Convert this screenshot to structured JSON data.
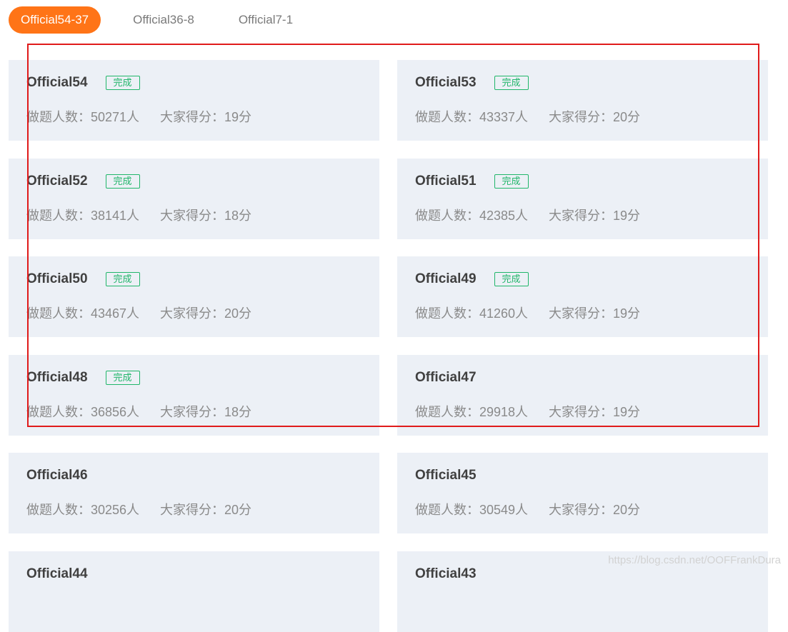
{
  "tabs": [
    {
      "label": "Official54-37",
      "active": true
    },
    {
      "label": "Official36-8",
      "active": false
    },
    {
      "label": "Official7-1",
      "active": false
    }
  ],
  "cards": [
    {
      "title": "Official54",
      "badge": "完成",
      "people": "做题人数：50271人",
      "score": "大家得分：19分"
    },
    {
      "title": "Official53",
      "badge": "完成",
      "people": "做题人数：43337人",
      "score": "大家得分：20分"
    },
    {
      "title": "Official52",
      "badge": "完成",
      "people": "做题人数：38141人",
      "score": "大家得分：18分"
    },
    {
      "title": "Official51",
      "badge": "完成",
      "people": "做题人数：42385人",
      "score": "大家得分：19分"
    },
    {
      "title": "Official50",
      "badge": "完成",
      "people": "做题人数：43467人",
      "score": "大家得分：20分"
    },
    {
      "title": "Official49",
      "badge": "完成",
      "people": "做题人数：41260人",
      "score": "大家得分：19分"
    },
    {
      "title": "Official48",
      "badge": "完成",
      "people": "做题人数：36856人",
      "score": "大家得分：18分"
    },
    {
      "title": "Official47",
      "badge": "",
      "people": "做题人数：29918人",
      "score": "大家得分：19分"
    },
    {
      "title": "Official46",
      "badge": "",
      "people": "做题人数：30256人",
      "score": "大家得分：20分"
    },
    {
      "title": "Official45",
      "badge": "",
      "people": "做题人数：30549人",
      "score": "大家得分：20分"
    },
    {
      "title": "Official44",
      "badge": "",
      "people": "",
      "score": ""
    },
    {
      "title": "Official43",
      "badge": "",
      "people": "",
      "score": ""
    }
  ],
  "watermark": "https://blog.csdn.net/OOFFrankDura",
  "colors": {
    "accent": "#ff7417",
    "card_bg": "#ecf0f6",
    "badge_green": "#21b66a",
    "highlight_red": "#e01b1b"
  }
}
